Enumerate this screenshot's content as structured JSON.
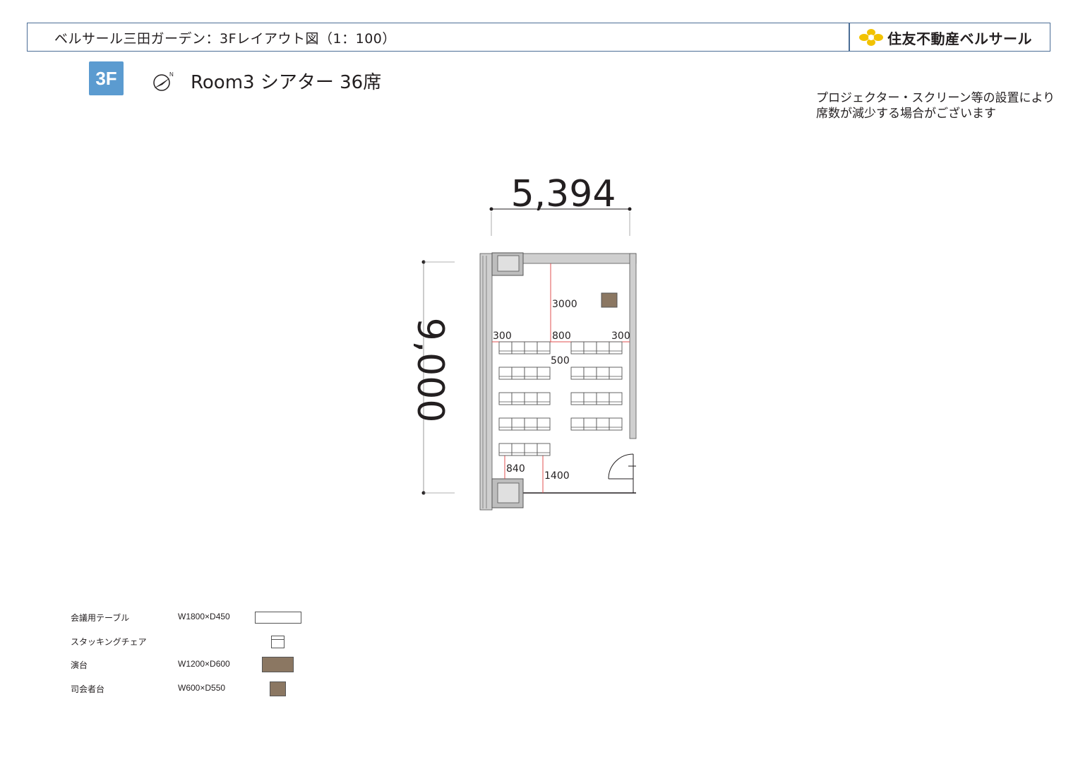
{
  "header": {
    "title": "ベルサール三田ガーデン：3Fレイアウト図（1：100）",
    "brand": "住友不動産ベルサール",
    "brand_color": "#f2c200",
    "border_color": "#4a6d96"
  },
  "floor_badge": {
    "label": "3F",
    "color": "#5b9bd0"
  },
  "north_arrow": {
    "icon": "north-arrow-icon",
    "label": "N"
  },
  "room_title": "Room3 シアター 36席",
  "notice": {
    "line1": "プロジェクター・スクリーン等の設置により",
    "line2": "席数が減少する場合がございます"
  },
  "floorplan": {
    "width_dimension": "5,394",
    "height_dimension": "9,000",
    "dim_3000": "3000",
    "dim_300_left": "300",
    "dim_800": "800",
    "dim_300_right": "300",
    "dim_500": "500",
    "dim_840": "840",
    "dim_1400": "1400",
    "seat_count": 36,
    "stage_color": "#8b7762"
  },
  "legend": [
    {
      "label": "会議用テーブル",
      "size": "W1800×D450",
      "swatch": "table"
    },
    {
      "label": "スタッキングチェア",
      "size": "",
      "swatch": "chair"
    },
    {
      "label": "演台",
      "size": "W1200×D600",
      "swatch": "podium"
    },
    {
      "label": "司会者台",
      "size": "W600×D550",
      "swatch": "mc-stand"
    }
  ]
}
